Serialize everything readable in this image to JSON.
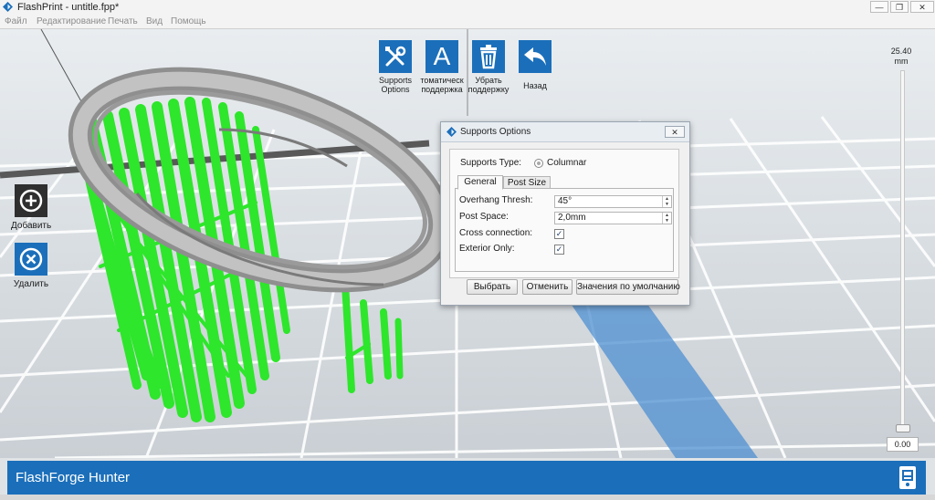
{
  "window": {
    "title": "FlashPrint - untitle.fpp*",
    "controls": {
      "minimize": "—",
      "maximize": "❐",
      "close": "✕"
    }
  },
  "menu": {
    "items": [
      "Файл",
      "Редактирование",
      "Печать",
      "Вид",
      "Помощь"
    ]
  },
  "toolbar": {
    "supports_options": "Supports\nOptions",
    "auto_support": "томатическ\nподдержка",
    "remove_support": "Убрать\nподдержку",
    "back": "Назад",
    "auto_icon_letter": "A",
    "icons": [
      "tools-icon",
      "letter-a-icon",
      "trash-icon",
      "undo-arrow-icon"
    ]
  },
  "sidebar": {
    "add_label": "Добавить",
    "delete_label": "Удалить",
    "icons": [
      "plus-circle-icon",
      "x-circle-icon"
    ]
  },
  "zoom": {
    "max_value": "25.40",
    "unit": "mm",
    "current_value": "0.00"
  },
  "dialog": {
    "title": "Supports Options",
    "supports_type_label": "Supports Type:",
    "supports_type_value": "Columnar",
    "tabs": [
      "General",
      "Post Size"
    ],
    "active_tab": "General",
    "fields": {
      "overhang_label": "Overhang Thresh:",
      "overhang_value": "45°",
      "post_space_label": "Post Space:",
      "post_space_value": "2,0mm",
      "cross_connection_label": "Cross connection:",
      "cross_connection_checked": true,
      "exterior_only_label": "Exterior Only:",
      "exterior_only_checked": true
    },
    "check_mark": "✓",
    "buttons": {
      "select": "Выбрать",
      "cancel": "Отменить",
      "defaults": "Значения по умолчанию"
    }
  },
  "status_bar": {
    "machine_name": "FlashForge Hunter"
  },
  "colors": {
    "accent_blue": "#1b6fba",
    "support_green": "#2ee62b",
    "model_gray": "#a9a9a9",
    "floor_shadow_blue": "#4d8fd1"
  }
}
